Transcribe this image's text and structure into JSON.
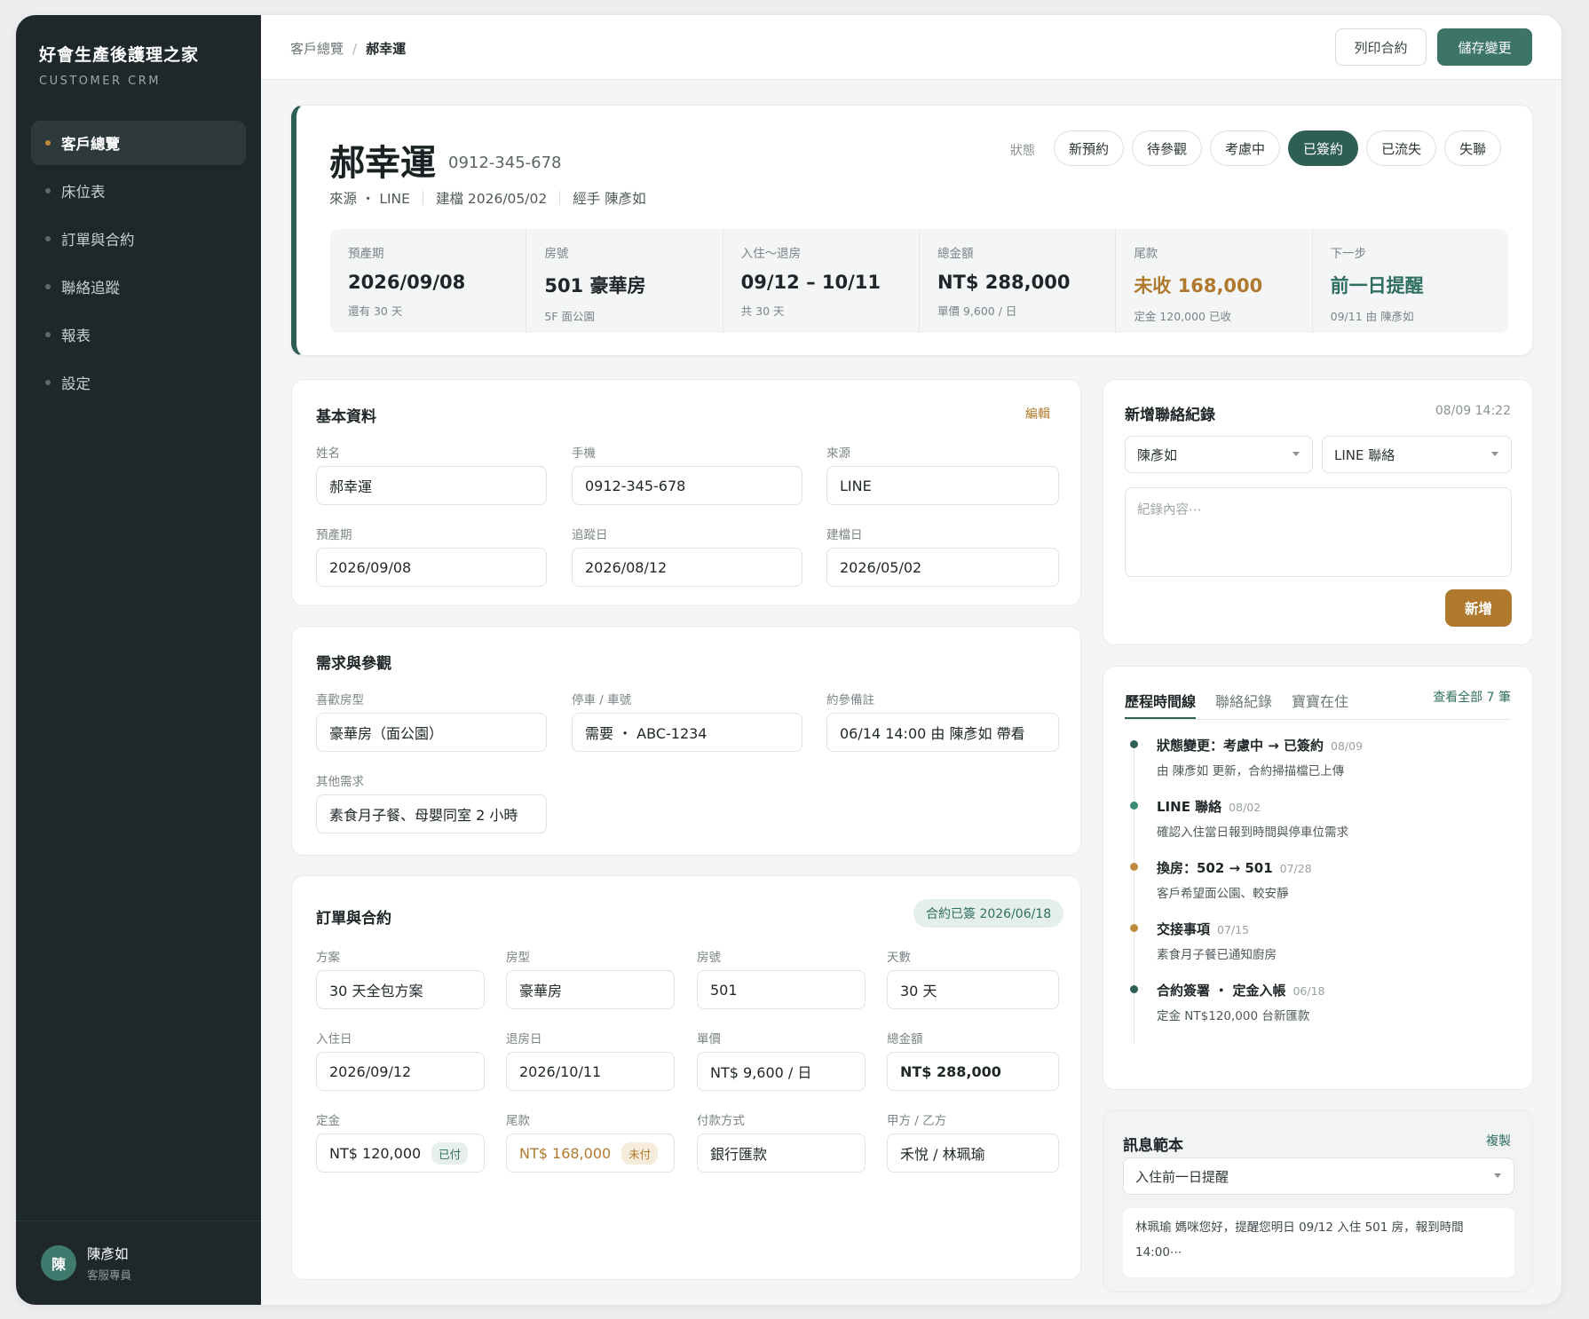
{
  "app": {
    "title": "好會生產後護理之家",
    "subtitle": "CUSTOMER CRM"
  },
  "nav": [
    {
      "label": "客戶總覽",
      "active": true
    },
    {
      "label": "床位表"
    },
    {
      "label": "訂單與合約"
    },
    {
      "label": "聯絡追蹤"
    },
    {
      "label": "報表"
    },
    {
      "label": "設定"
    }
  ],
  "user": {
    "initial": "陳",
    "name": "陳彥如",
    "role": "客服專員"
  },
  "breadcrumb": {
    "parent": "客戶總覽",
    "sep": "/",
    "current": "郝幸運"
  },
  "toolbar": {
    "print": "列印合約",
    "save": "儲存變更"
  },
  "customer": {
    "name": "郝幸運",
    "phone": "0912-345-678",
    "source": "來源 ・ LINE",
    "created": "建檔 2026/05/02",
    "handler": "經手 陳彥如"
  },
  "status": {
    "label": "狀態",
    "options": [
      "新預約",
      "待參觀",
      "考慮中",
      "已簽約",
      "已流失",
      "失聯"
    ],
    "active": "已簽約"
  },
  "stats": [
    {
      "label": "預產期",
      "value": "2026/09/08",
      "note": "還有 30 天"
    },
    {
      "label": "房號",
      "value": "501 豪華房",
      "note": "5F 面公園"
    },
    {
      "label": "入住～退房",
      "value": "09/12 – 10/11",
      "note": "共 30 天"
    },
    {
      "label": "總金額",
      "value": "NT$ 288,000",
      "note": "單價 9,600 / 日"
    },
    {
      "label": "尾款",
      "value": "未收 168,000",
      "note": "定金 120,000 已收"
    },
    {
      "label": "下一步",
      "value": "前一日提醒",
      "note": "09/11 由 陳彥如"
    }
  ],
  "basic": {
    "title": "基本資料",
    "edit": "編輯",
    "name_label": "姓名",
    "name": "郝幸運",
    "phone_label": "手機",
    "phone": "0912-345-678",
    "source_label": "來源",
    "source": "LINE",
    "due_label": "預產期",
    "due": "2026/09/08",
    "follow_label": "追蹤日",
    "follow": "2026/08/12",
    "created_label": "建檔日",
    "created": "2026/05/02"
  },
  "needs": {
    "title": "需求與參觀",
    "room_label": "喜歡房型",
    "room": "豪華房（面公園）",
    "parking_label": "停車 / 車號",
    "parking": "需要 ・ ABC-1234",
    "visit_label": "約參備註",
    "visit": "06/14 14:00 由 陳彥如 帶看",
    "other_label": "其他需求",
    "other": "素食月子餐、母嬰同室 2 小時"
  },
  "order": {
    "title": "訂單與合約",
    "badge": "合約已簽 2026/06/18",
    "plan_label": "方案",
    "plan": "30 天全包方案",
    "type_label": "房型",
    "type": "豪華房",
    "room_label": "房號",
    "room": "501",
    "days_label": "天數",
    "days": "30 天",
    "checkin_label": "入住日",
    "checkin": "2026/09/12",
    "checkout_label": "退房日",
    "checkout": "2026/10/11",
    "price_label": "單價",
    "price": "NT$ 9,600 / 日",
    "total_label": "總金額",
    "total": "NT$ 288,000",
    "deposit_label": "定金",
    "deposit": "NT$ 120,000",
    "deposit_tag": "已付",
    "balance_label": "尾款",
    "balance": "NT$ 168,000",
    "balance_tag": "未付",
    "pay_label": "付款方式",
    "pay": "銀行匯款",
    "parties_label": "甲方 / 乙方",
    "parties": "禾悅 / 林珮瑜"
  },
  "contact": {
    "title": "新增聯絡紀錄",
    "time": "08/09 14:22",
    "staff": "陳彥如",
    "channel": "LINE 聯絡",
    "placeholder": "紀錄內容⋯",
    "add": "新增"
  },
  "timeline": {
    "tabs": [
      "歷程時間線",
      "聯絡紀錄",
      "寶寶在住"
    ],
    "view_all": "查看全部 7 筆",
    "items": [
      {
        "title": "狀態變更：考慮中 → 已簽約",
        "date": "08/09",
        "desc": "由 陳彥如 更新，合約掃描檔已上傳",
        "color": "#2f5e54"
      },
      {
        "title": "LINE 聯絡",
        "date": "08/02",
        "desc": "確認入住當日報到時間與停車位需求",
        "color": "#3c8a78"
      },
      {
        "title": "換房：502 → 501",
        "date": "07/28",
        "desc": "客戶希望面公園、較安靜",
        "color": "#c08a3e"
      },
      {
        "title": "交接事項",
        "date": "07/15",
        "desc": "素食月子餐已通知廚房",
        "color": "#c08a3e"
      },
      {
        "title": "合約簽署 ・ 定金入帳",
        "date": "06/18",
        "desc": "定金 NT$120,000 台新匯款",
        "color": "#2f5e54"
      }
    ]
  },
  "template": {
    "title": "訊息範本",
    "copy": "複製",
    "selected": "入住前一日提醒",
    "body": "林珮瑜 媽咪您好，提醒您明日 09/12 入住 501 房，報到時間 14:00⋯"
  }
}
